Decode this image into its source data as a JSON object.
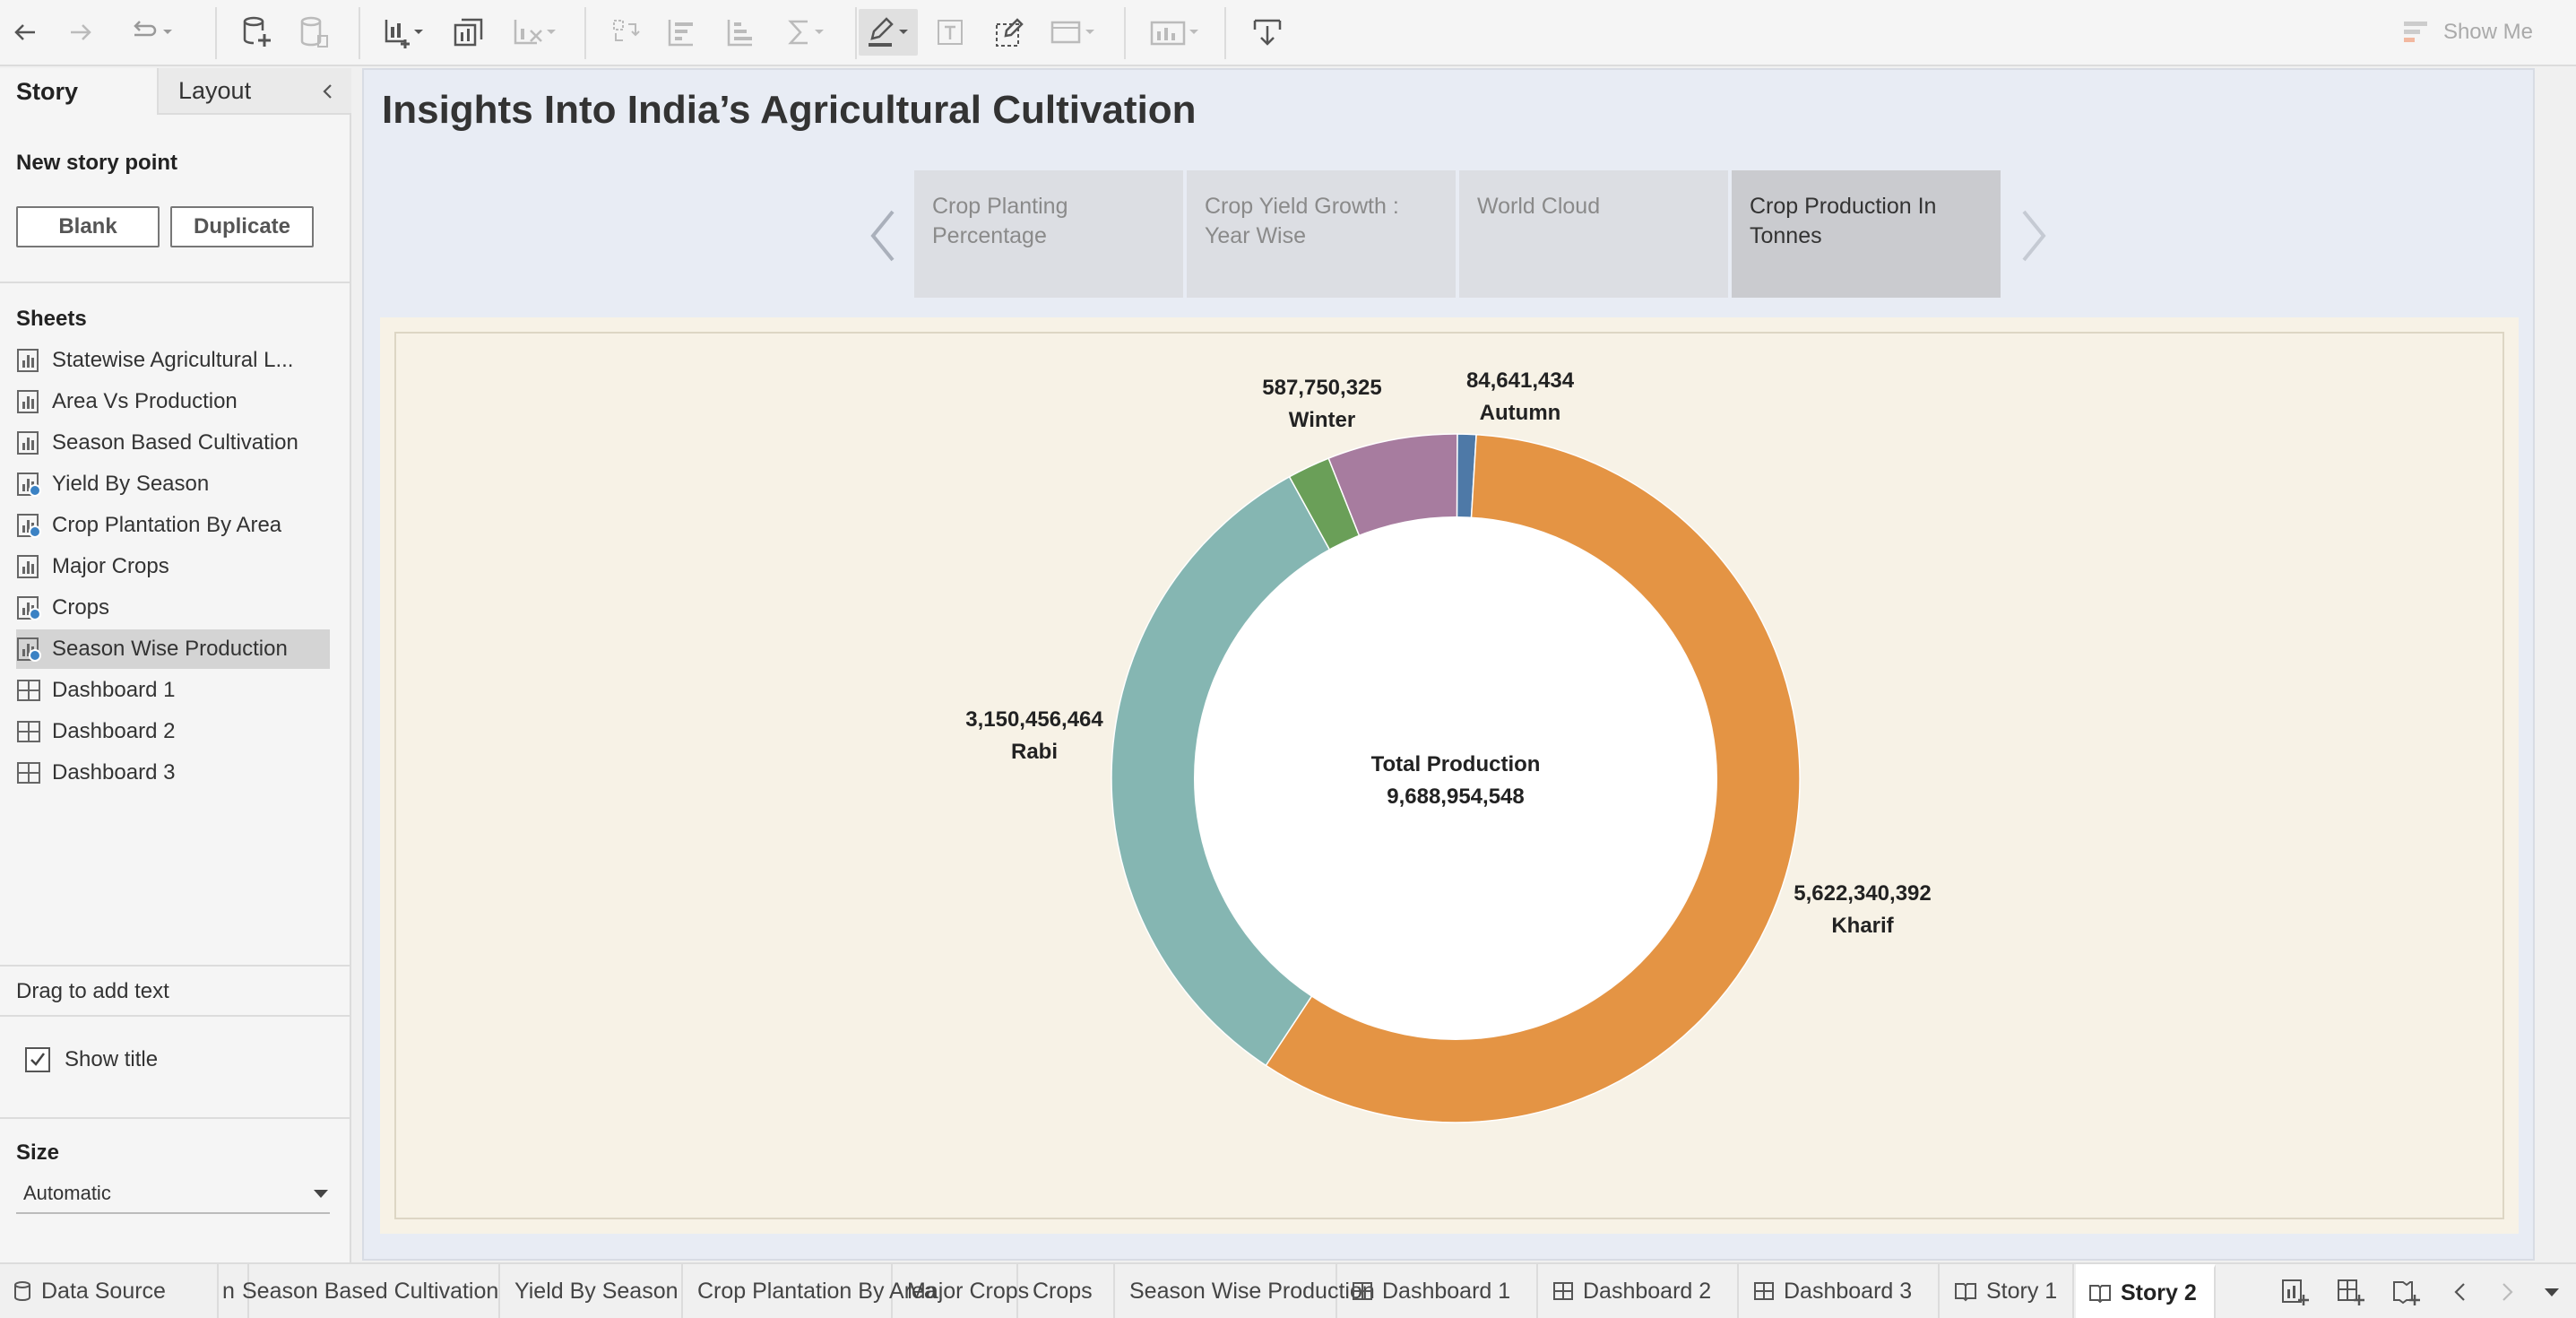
{
  "toolbar": {
    "show_me_label": "Show Me"
  },
  "left_panel": {
    "tabs": [
      "Story",
      "Layout"
    ],
    "new_story_point_label": "New story point",
    "blank_label": "Blank",
    "duplicate_label": "Duplicate",
    "sheets_label": "Sheets",
    "sheets": [
      {
        "label": "Statewise Agricultural L...",
        "type": "worksheet",
        "badge": false
      },
      {
        "label": "Area Vs Production",
        "type": "worksheet",
        "badge": false
      },
      {
        "label": "Season Based Cultivation",
        "type": "worksheet",
        "badge": false
      },
      {
        "label": "Yield By Season",
        "type": "worksheet",
        "badge": true
      },
      {
        "label": "Crop Plantation By Area",
        "type": "worksheet",
        "badge": true
      },
      {
        "label": "Major Crops",
        "type": "worksheet",
        "badge": false
      },
      {
        "label": "Crops",
        "type": "worksheet",
        "badge": true
      },
      {
        "label": "Season Wise Production",
        "type": "worksheet",
        "badge": true,
        "selected": true
      },
      {
        "label": "Dashboard 1",
        "type": "dashboard",
        "badge": false
      },
      {
        "label": "Dashboard 2",
        "type": "dashboard",
        "badge": false
      },
      {
        "label": "Dashboard 3",
        "type": "dashboard",
        "badge": false
      }
    ],
    "drag_text": "Drag to add text",
    "show_title_label": "Show title",
    "show_title_checked": true,
    "size_label": "Size",
    "size_value": "Automatic"
  },
  "story": {
    "title": "Insights Into India’s Agricultural Cultivation",
    "points": [
      {
        "label": "Crop Planting Percentage"
      },
      {
        "label": "Crop Yield Growth : Year Wise"
      },
      {
        "label": "World Cloud"
      },
      {
        "label": "Crop Production In Tonnes",
        "active": true
      }
    ]
  },
  "chart_data": {
    "type": "pie",
    "variant": "donut",
    "center_label": "Total Production",
    "total": 9688954548,
    "total_label": "9,688,954,548",
    "slices": [
      {
        "name": "Autumn",
        "value": 84641434,
        "value_label": "84,641,434",
        "color": "#4e79a7"
      },
      {
        "name": "Kharif",
        "value": 5622340392,
        "value_label": "5,622,340,392",
        "color": "#e49444"
      },
      {
        "name": "Rabi",
        "value": 3150456464,
        "value_label": "3,150,456,464",
        "color": "#85b6b2"
      },
      {
        "name": "",
        "value": 193000000,
        "value_label": "",
        "color": "#6a9f58"
      },
      {
        "name": "Winter",
        "value": 587750325,
        "value_label": "587,750,325",
        "color": "#a77c9f"
      }
    ]
  },
  "bottom_tabs": [
    {
      "label": "Data Source",
      "icon": "database-icon"
    },
    {
      "label": "n",
      "icon": ""
    },
    {
      "label": "Season Based Cultivation",
      "icon": ""
    },
    {
      "label": "Yield By Season",
      "icon": ""
    },
    {
      "label": "Crop Plantation By Area",
      "icon": ""
    },
    {
      "label": "Major Crops",
      "icon": ""
    },
    {
      "label": "Crops",
      "icon": ""
    },
    {
      "label": "Season Wise Production",
      "icon": ""
    },
    {
      "label": "Dashboard 1",
      "icon": "dashboard-icon"
    },
    {
      "label": "Dashboard 2",
      "icon": "dashboard-icon"
    },
    {
      "label": "Dashboard 3",
      "icon": "dashboard-icon"
    },
    {
      "label": "Story 1",
      "icon": "story-icon"
    },
    {
      "label": "Story 2",
      "icon": "story-icon",
      "active": true
    }
  ]
}
